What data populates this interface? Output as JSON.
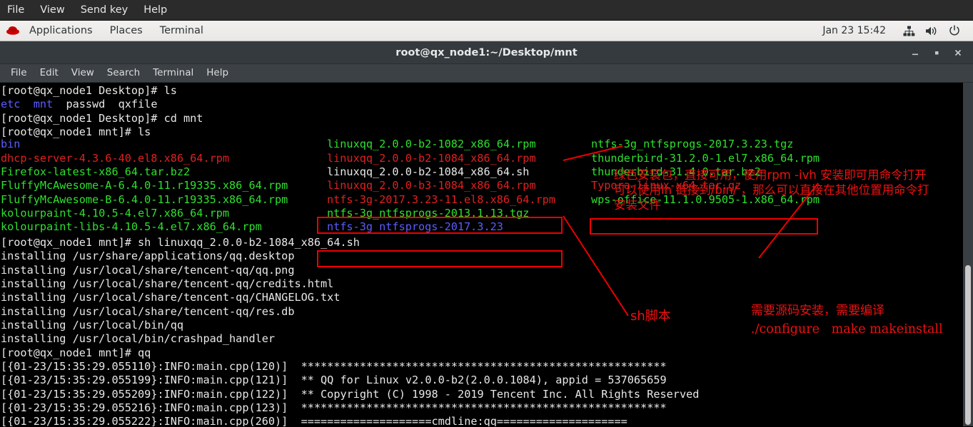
{
  "vm_menubar": {
    "items": [
      "File",
      "View",
      "Send key",
      "Help"
    ]
  },
  "gnome_panel": {
    "logo_name": "redhat-logo",
    "items": [
      "Applications",
      "Places",
      "Terminal"
    ],
    "clock": "Jan 23  15:42",
    "tray_icons": [
      "network-icon",
      "volume-icon",
      "power-icon"
    ]
  },
  "terminal": {
    "title": "root@qx_node1:~/Desktop/mnt",
    "window_buttons": [
      "minimize-button",
      "maximize-button",
      "close-button"
    ],
    "menu": [
      "File",
      "Edit",
      "View",
      "Search",
      "Terminal",
      "Help"
    ],
    "lines": [
      {
        "segments": [
          {
            "text": "[root@qx_node1 Desktop]# ls",
            "color": "white"
          }
        ]
      },
      {
        "segments": [
          {
            "text": "etc",
            "color": "blue"
          },
          {
            "text": "  ",
            "color": "white"
          },
          {
            "text": "mnt",
            "color": "blue"
          },
          {
            "text": "  passwd  qxfile",
            "color": "white"
          }
        ]
      },
      {
        "segments": [
          {
            "text": "[root@qx_node1 Desktop]# cd mnt",
            "color": "white"
          }
        ]
      },
      {
        "segments": [
          {
            "text": "[root@qx_node1 mnt]# ls",
            "color": "white"
          }
        ]
      }
    ],
    "ls_columns": [
      {
        "entries": [
          {
            "text": "bin",
            "color": "blue"
          },
          {
            "text": "dhcp-server-4.3.6-40.el8.x86_64.rpm",
            "color": "red"
          },
          {
            "text": "Firefox-latest-x86_64.tar.bz2",
            "color": "green"
          },
          {
            "text": "FluffyMcAwesome-A-6.4.0-11.r19335.x86_64.rpm",
            "color": "green"
          },
          {
            "text": "FluffyMcAwesome-B-6.4.0-11.r19335.x86_64.rpm",
            "color": "green"
          },
          {
            "text": "kolourpaint-4.10.5-4.el7.x86_64.rpm",
            "color": "green"
          },
          {
            "text": "kolourpaint-libs-4.10.5-4.el7.x86_64.rpm",
            "color": "green"
          }
        ]
      },
      {
        "entries": [
          {
            "text": "linuxqq_2.0.0-b2-1082_x86_64.rpm",
            "color": "green"
          },
          {
            "text": "linuxqq_2.0.0-b2-1084_x86_64.rpm",
            "color": "red"
          },
          {
            "text": "linuxqq_2.0.0-b2-1084_x86_64.sh",
            "color": "white"
          },
          {
            "text": "linuxqq_2.0.0-b3-1084_x86_64.rpm",
            "color": "red"
          },
          {
            "text": "ntfs-3g-2017.3.23-11.el8.x86_64.rpm",
            "color": "red"
          },
          {
            "text": "ntfs-3g_ntfsprogs-2013.1.13.tgz",
            "color": "green"
          },
          {
            "text": "ntfs-3g_ntfsprogs-2017.3.23",
            "color": "blue"
          }
        ]
      },
      {
        "entries": [
          {
            "text": "ntfs-3g_ntfsprogs-2017.3.23.tgz",
            "color": "green"
          },
          {
            "text": "thunderbird-31.2.0-1.el7.x86_64.rpm",
            "color": "green"
          },
          {
            "text": "thunderbird-31.4.0.tar.bz2",
            "color": "green"
          },
          {
            "text": "Typora-linux-x64.tar.gz",
            "color": "red"
          },
          {
            "text": "wps-office-11.1.0.9505-1.x86_64.rpm",
            "color": "green"
          }
        ]
      }
    ],
    "output_lines": [
      "[root@qx_node1 mnt]# sh linuxqq_2.0.0-b2-1084_x86_64.sh",
      "installing /usr/share/applications/qq.desktop",
      "installing /usr/local/share/tencent-qq/qq.png",
      "installing /usr/local/share/tencent-qq/credits.html",
      "installing /usr/local/share/tencent-qq/CHANGELOG.txt",
      "installing /usr/local/share/tencent-qq/res.db",
      "installing /usr/local/bin/qq",
      "installing /usr/local/bin/crashpad_handler",
      "[root@qx_node1 mnt]# qq",
      "[{01-23/15:35:29.055110}:INFO:main.cpp(120)]  ********************************************************",
      "[{01-23/15:35:29.055199}:INFO:main.cpp(121)]  ** QQ for Linux v2.0.0-b2(2.0.0.1084), appid = 537065659",
      "[{01-23/15:35:29.055209}:INFO:main.cpp(122)]  ** Copyright (C) 1998 - 2019 Tencent Inc. All Rights Reserved",
      "[{01-23/15:35:29.055216}:INFO:main.cpp(123)]  ********************************************************",
      "[{01-23/15:35:29.055222}:INFO:main.cpp(260)]  ====================cmdline:qq===================="
    ]
  },
  "annotations": {
    "color": "#f01010",
    "top_right": [
      "绿色安装包，直接可用，使用rpm -ivh 安装即可用命令打开",
      "可以使用ln 链接到/bin/ ，那么可以直接在其他位置用命令打",
      "安装文件"
    ],
    "sh_label": "sh脚本",
    "source_install": [
      "需要源码安装，需要编译",
      "./configure   make makeinstall"
    ]
  }
}
